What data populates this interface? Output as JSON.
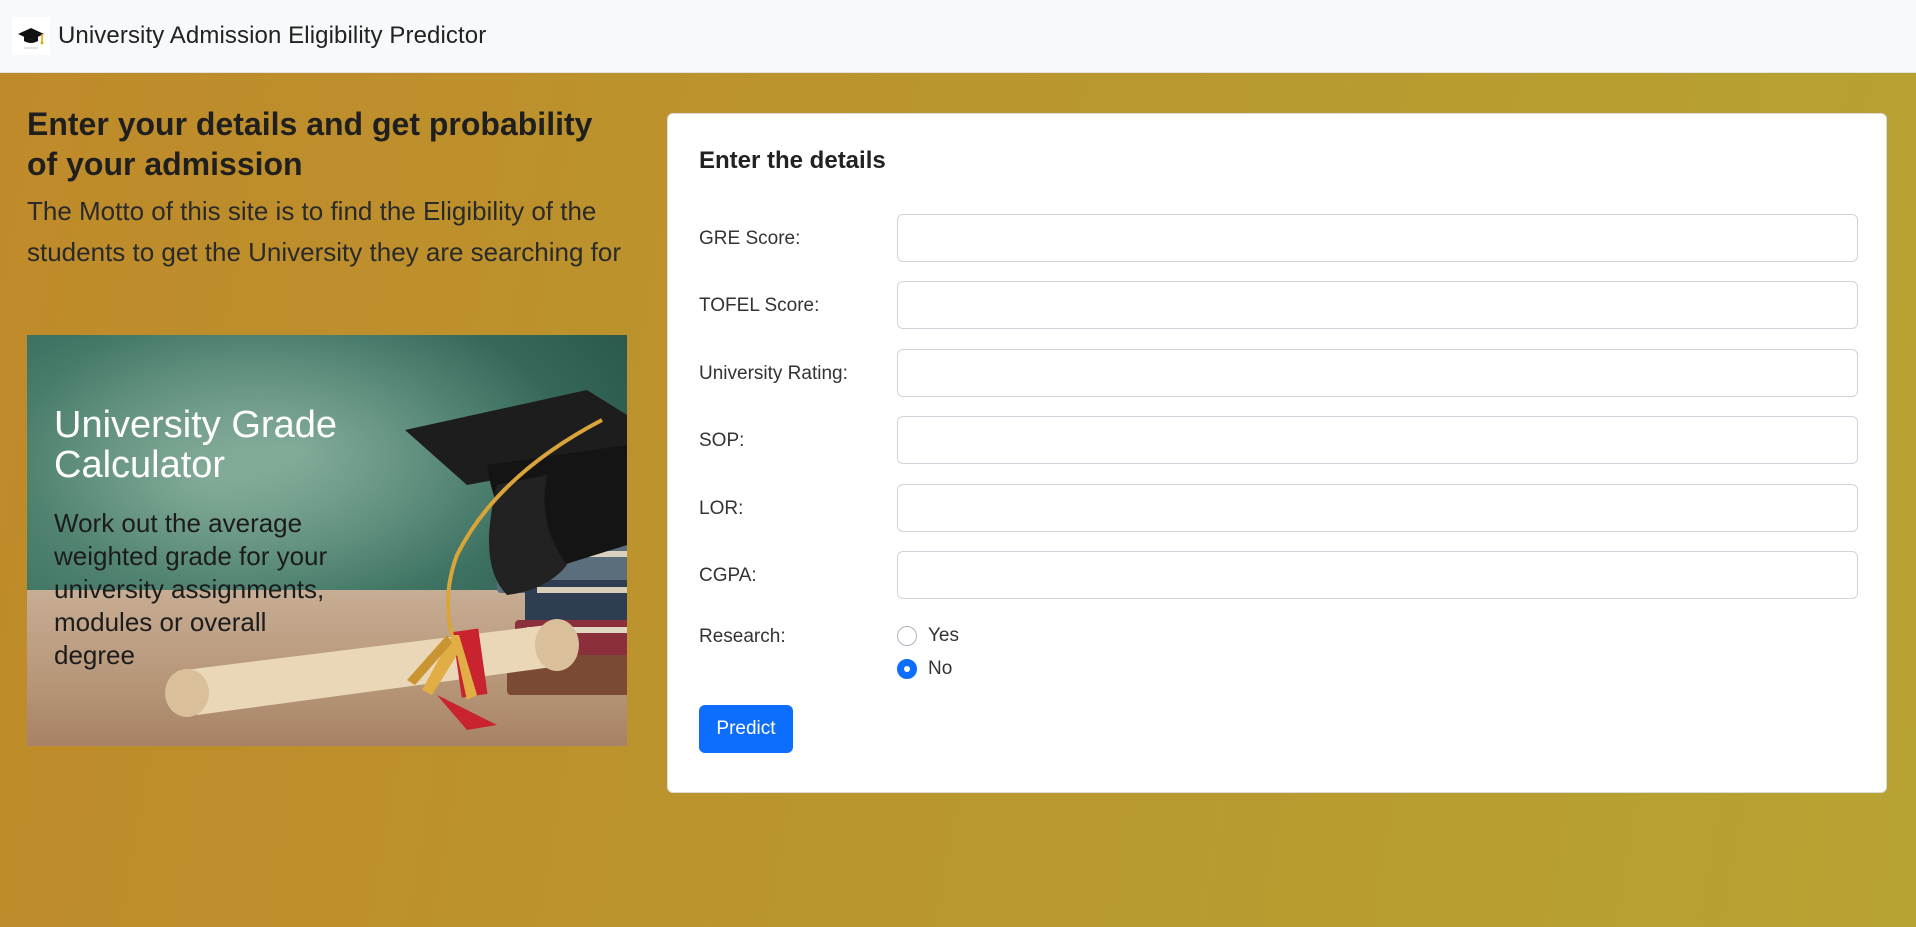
{
  "navbar": {
    "title": "University Admission Eligibility Predictor",
    "logo_icon": "graduation-cap-icon"
  },
  "intro": {
    "heading": "Enter your details and get probability of your admission",
    "motto": "The Motto of this site is to find the Eligibility of the students to get the University they are searching for"
  },
  "banner": {
    "title": "University Grade Calculator",
    "subtitle": "Work out the average weighted grade for your university assignments, modules or overall degree"
  },
  "form": {
    "title": "Enter the details",
    "fields": [
      {
        "label": "GRE Score:",
        "value": ""
      },
      {
        "label": "TOFEL Score:",
        "value": ""
      },
      {
        "label": "University Rating:",
        "value": ""
      },
      {
        "label": "SOP:",
        "value": ""
      },
      {
        "label": "LOR:",
        "value": ""
      },
      {
        "label": "CGPA:",
        "value": ""
      }
    ],
    "research": {
      "label": "Research:",
      "options": [
        {
          "label": "Yes",
          "checked": false
        },
        {
          "label": "No",
          "checked": true
        }
      ]
    },
    "submit_label": "Predict"
  },
  "colors": {
    "accent": "#0d6efd",
    "background": "#bf8f2b"
  }
}
